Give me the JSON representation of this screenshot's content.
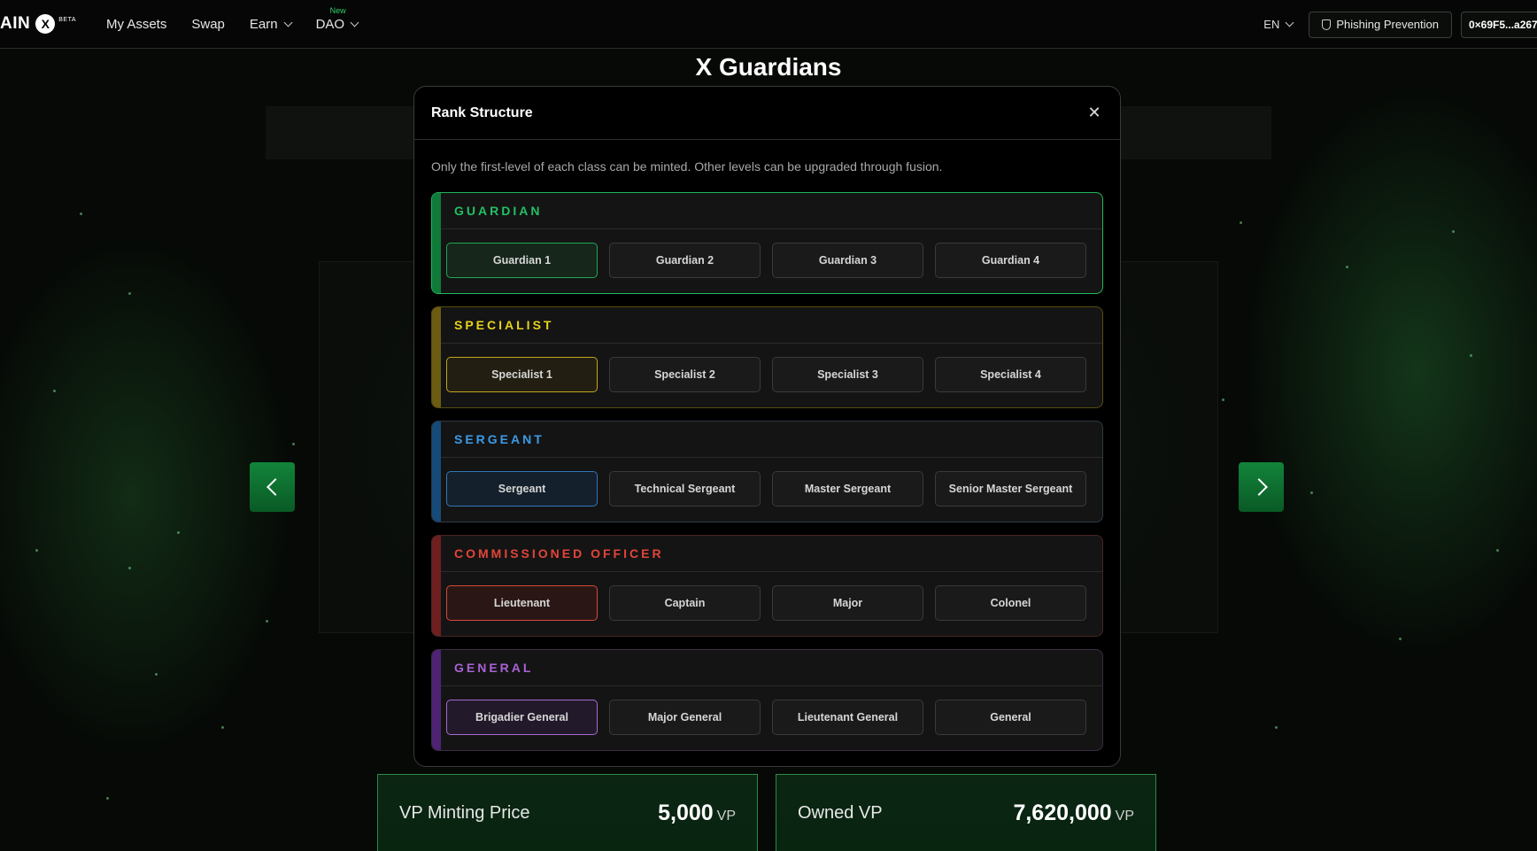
{
  "nav": {
    "logo_text": "AIN",
    "logo_badge": "BETA",
    "links": [
      {
        "label": "My Assets"
      },
      {
        "label": "Swap"
      },
      {
        "label": "Earn"
      },
      {
        "label": "DAO",
        "badge": "New"
      }
    ],
    "language": "EN",
    "phishing_label": "Phishing Prevention",
    "wallet_address": "0×69F5...a267"
  },
  "page": {
    "title": "X Guardians"
  },
  "stats": {
    "minting_label": "VP Minting Price",
    "minting_value": "5,000",
    "minting_unit": "VP",
    "owned_label": "Owned VP",
    "owned_value": "7,620,000",
    "owned_unit": "VP"
  },
  "modal": {
    "title": "Rank Structure",
    "description": "Only the first-level of each class can be minted. Other levels can be upgraded through fusion.",
    "classes": [
      {
        "name": "GUARDIAN",
        "color": "#23c063",
        "levels": [
          "Guardian 1",
          "Guardian 2",
          "Guardian 3",
          "Guardian 4"
        ]
      },
      {
        "name": "SPECIALIST",
        "color": "#e6d21e",
        "levels": [
          "Specialist 1",
          "Specialist 2",
          "Specialist 3",
          "Specialist 4"
        ]
      },
      {
        "name": "SERGEANT",
        "color": "#3c9be6",
        "levels": [
          "Sergeant",
          "Technical Sergeant",
          "Master Sergeant",
          "Senior Master Sergeant"
        ]
      },
      {
        "name": "COMMISSIONED OFFICER",
        "color": "#e2453a",
        "levels": [
          "Lieutenant",
          "Captain",
          "Major",
          "Colonel"
        ]
      },
      {
        "name": "GENERAL",
        "color": "#a862d6",
        "levels": [
          "Brigadier General",
          "Major General",
          "Lieutenant General",
          "General"
        ]
      }
    ]
  },
  "icons": {
    "close": "close-icon",
    "prev": "chevron-left-icon",
    "next": "chevron-right-icon",
    "shield": "shield-icon",
    "dropdown": "chevron-down-icon"
  }
}
